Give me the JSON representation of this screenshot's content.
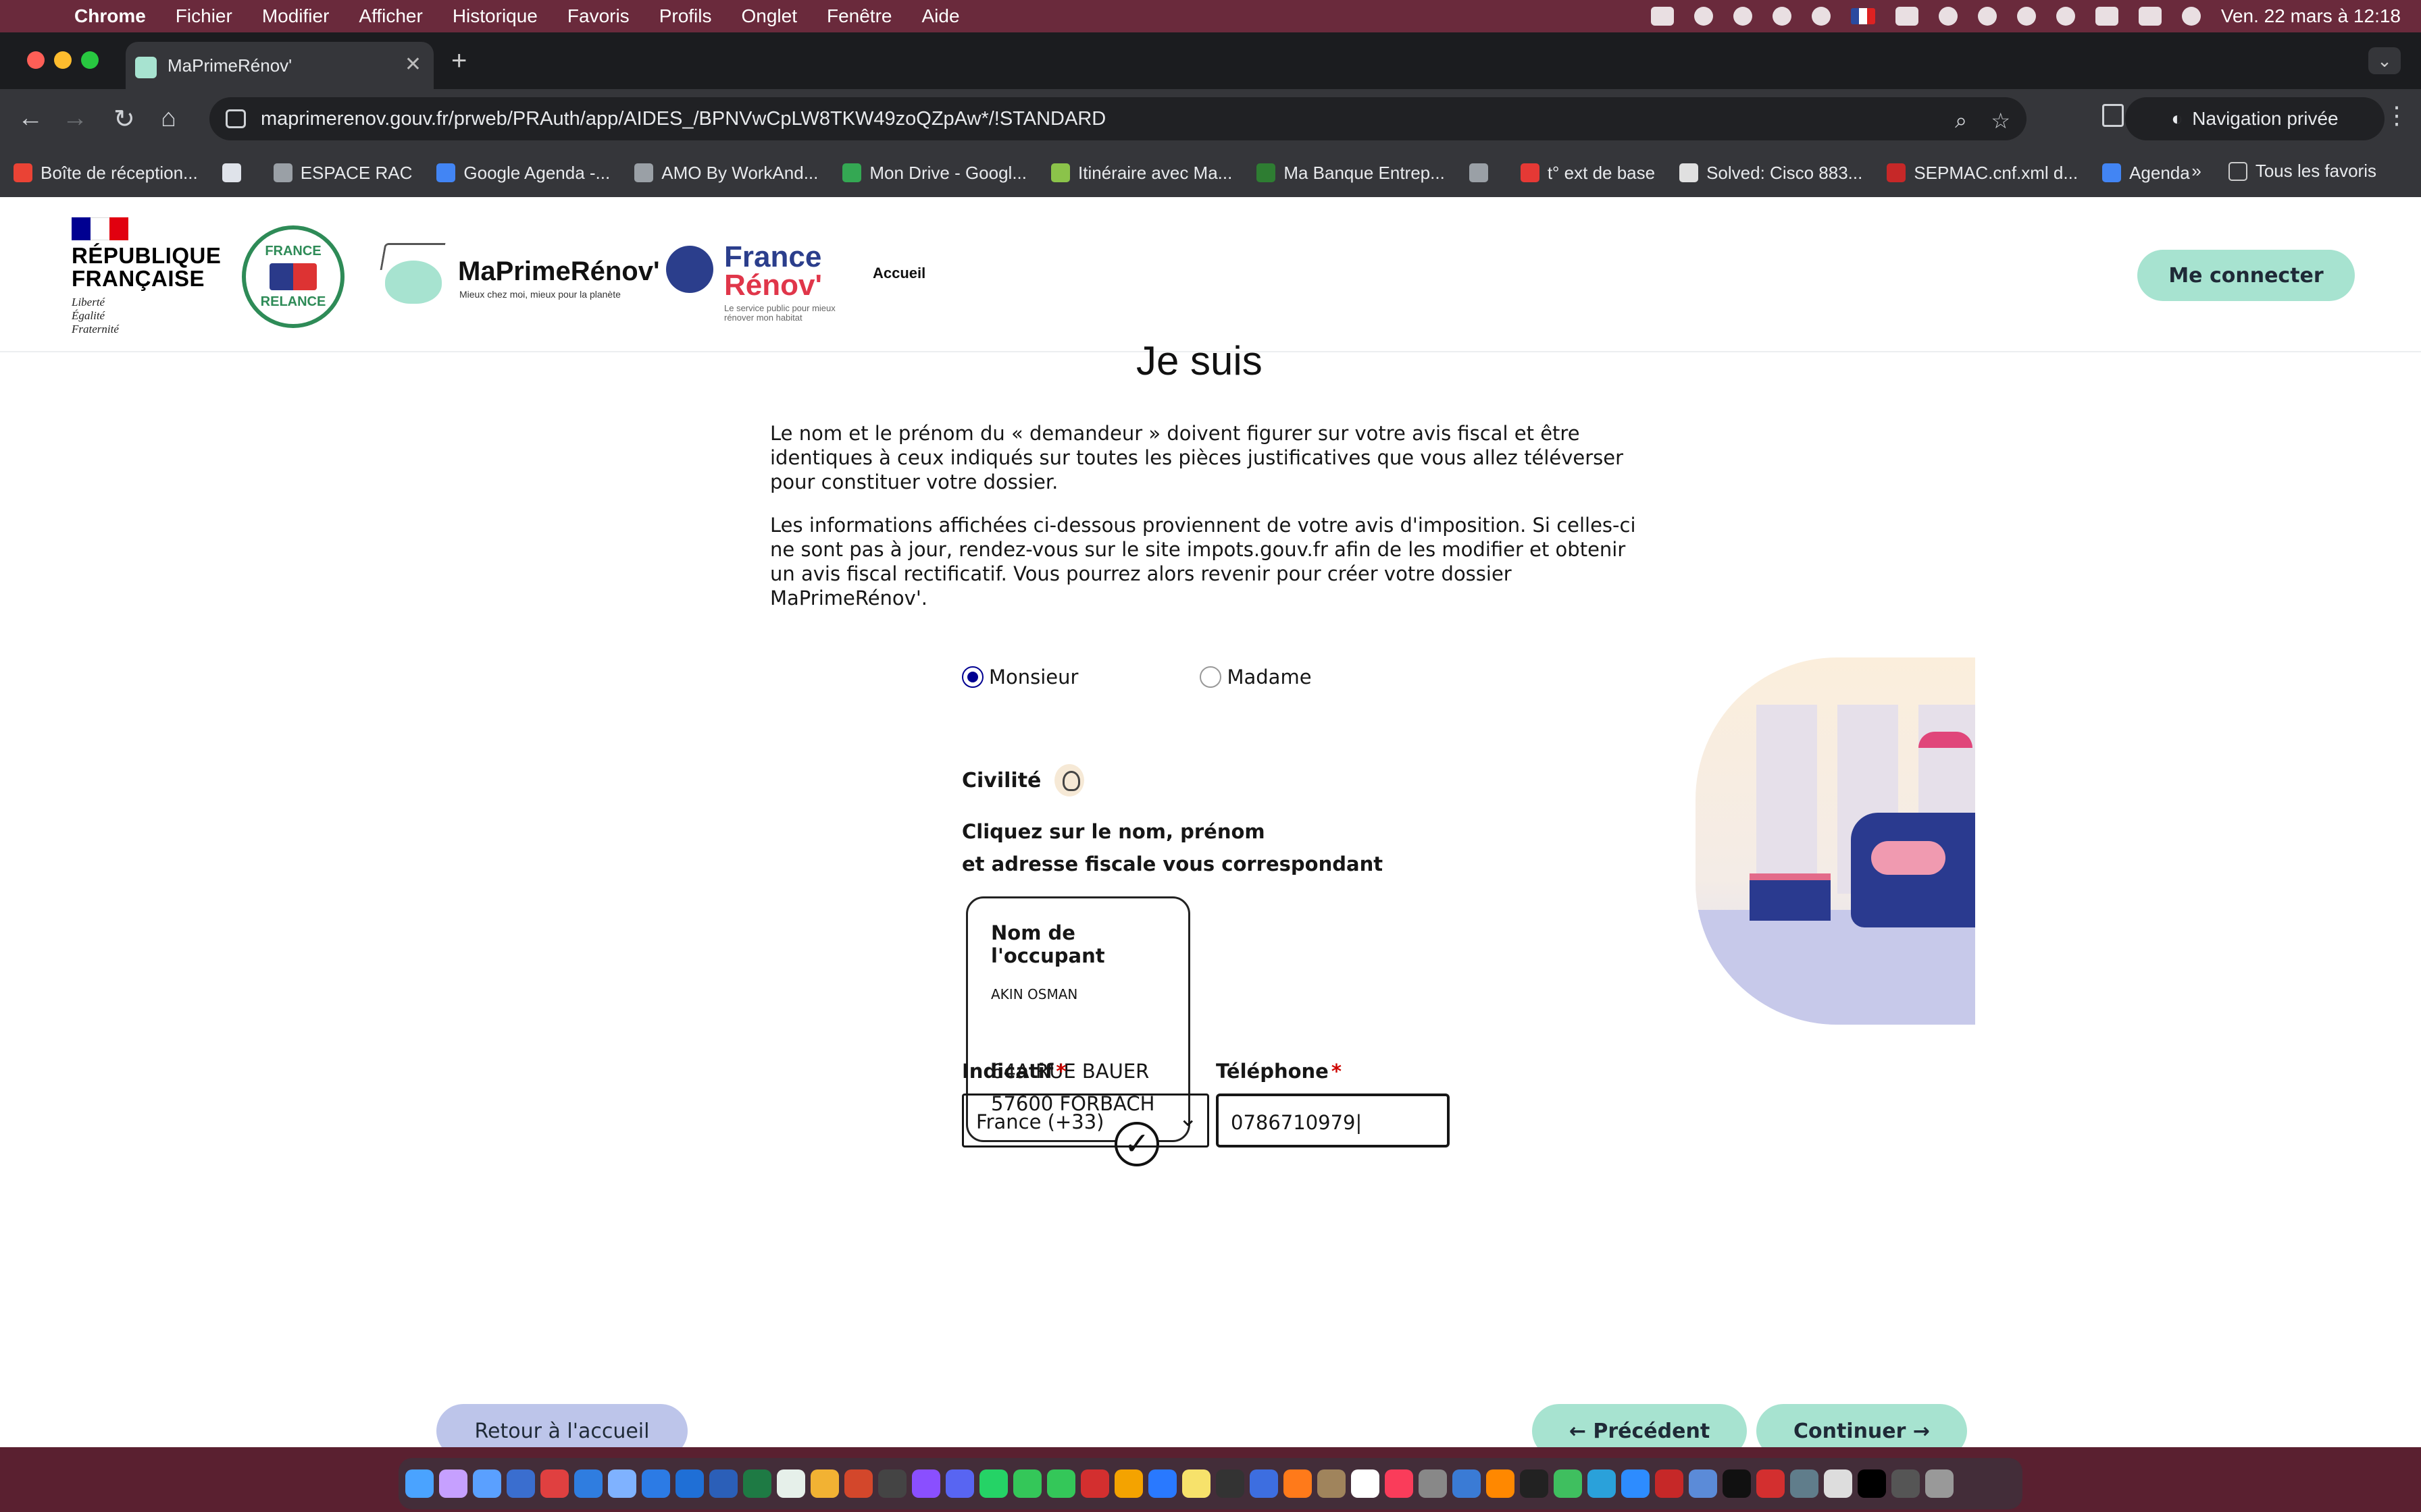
{
  "menubar": {
    "app": "Chrome",
    "items": [
      "Fichier",
      "Modifier",
      "Afficher",
      "Historique",
      "Favoris",
      "Profils",
      "Onglet",
      "Fenêtre",
      "Aide"
    ],
    "datetime": "Ven. 22 mars à 12:18"
  },
  "browser": {
    "tab_title": "MaPrimeRénov'",
    "url": "maprimerenov.gouv.fr/prweb/PRAuth/app/AIDES_/BPNVwCpLW8TKW49zoQZpAw*/!STANDARD",
    "private_label": "Navigation privée",
    "bookmarks": [
      {
        "label": "Boîte de réception...",
        "color": "#ea4335"
      },
      {
        "label": "",
        "color": "#dfe3ea"
      },
      {
        "label": "ESPACE RAC",
        "color": "#9aa0a6"
      },
      {
        "label": "Google Agenda -...",
        "color": "#4285f4"
      },
      {
        "label": "AMO By WorkAnd...",
        "color": "#9aa0a6"
      },
      {
        "label": "Mon Drive - Googl...",
        "color": "#34a853"
      },
      {
        "label": "Itinéraire avec Ma...",
        "color": "#8bc34a"
      },
      {
        "label": "Ma Banque Entrep...",
        "color": "#2e7d32"
      },
      {
        "label": "",
        "color": "#9aa0a6"
      },
      {
        "label": "t° ext de base",
        "color": "#e53935"
      },
      {
        "label": "Solved: Cisco 883...",
        "color": "#e0e0e0"
      },
      {
        "label": "SEPMAC.cnf.xml d...",
        "color": "#c62828"
      },
      {
        "label": "Agenda",
        "color": "#4285f4"
      }
    ],
    "all_bookmarks": "Tous les favoris"
  },
  "header": {
    "rf_title_line1": "RÉPUBLIQUE",
    "rf_title_line2": "FRANÇAISE",
    "motto_1": "Liberté",
    "motto_2": "Égalité",
    "motto_3": "Fraternité",
    "relance_top": "FRANCE",
    "relance_bottom": "RELANCE",
    "mpr_name": "MaPrimeRénov'",
    "mpr_tagline": "Mieux chez moi, mieux pour la planète",
    "fr_renov_1": "France",
    "fr_renov_2": "Rénov'",
    "fr_renov_tag": "Le service public pour mieux rénover mon habitat",
    "nav_accueil": "Accueil",
    "connect": "Me connecter"
  },
  "form": {
    "heading": "Je suis",
    "para1": "Le nom et le prénom du « demandeur » doivent figurer sur votre avis fiscal et être identiques à ceux indiqués sur toutes les pièces justificatives que vous allez téléverser pour constituer votre dossier.",
    "para2_a": "Les informations affichées ci-dessous proviennent de votre avis d'imposition. Si celles-ci ne sont pas à jour, rendez-vous sur le site ",
    "para2_link": "impots.gouv.fr",
    "para2_b": " afin de les modifier et obtenir un avis fiscal rectificatif. Vous pourrez alors revenir pour créer votre dossier MaPrimeRénov'.",
    "radio_monsieur": "Monsieur",
    "radio_madame": "Madame",
    "selected_civility": "Monsieur",
    "civilite_label": "Civilité",
    "instr_1": "Cliquez sur le nom, prénom",
    "instr_2": "et adresse fiscale vous correspondant",
    "card_title_1": "Nom de",
    "card_title_2": "l'occupant",
    "card_name": "AKIN OSMAN",
    "card_addr_1": "64A RUE BAUER",
    "card_addr_2": "57600 FORBACH",
    "indicatif_label": "Indicatif",
    "indicatif_value": "France (+33)",
    "phone_label": "Téléphone",
    "phone_value": "0786710979",
    "required_mark": "*"
  },
  "actions": {
    "retour": "Retour à l'accueil",
    "precedent": "← Précédent",
    "continuer": "Continuer →"
  },
  "colors": {
    "accent_mint": "#a7e3d0",
    "accent_lavender": "#bdc5ea",
    "radio_blue": "#000091",
    "required_red": "#ce0500"
  }
}
